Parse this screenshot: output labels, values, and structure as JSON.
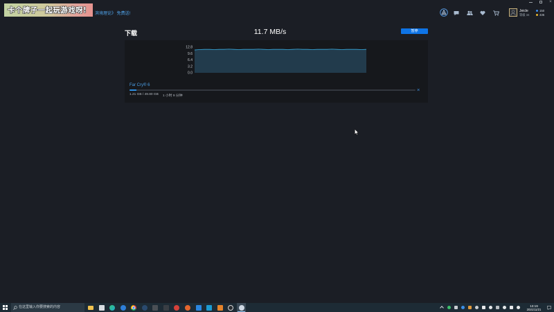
{
  "promo": {
    "banner_text": "卡个牌子一起玩游戏呀!",
    "link_text": "滨境理论》 免费送!"
  },
  "header": {
    "icons": [
      "ubisoft-logo-icon",
      "chat-icon",
      "friends-icon",
      "wishlist-heart-icon",
      "cart-icon"
    ],
    "user": {
      "name": "Jeicle",
      "level": "等级 34"
    },
    "wallet": {
      "units": "150",
      "coins": "435"
    }
  },
  "window_controls": [
    "minimize-icon",
    "restore-icon",
    "close-icon"
  ],
  "download": {
    "title": "下载",
    "speed": "11.7 MB/s",
    "pause_label": "暂停",
    "game_title": "Far Cry® 6",
    "size_progress": "1.21 GB / 49.80 GB",
    "time_remaining": "1 小时 9 分钟",
    "progress": 0.024
  },
  "colors": {
    "accent": "#0e74e6",
    "link": "#4c9fe6",
    "background": "#1b1e25",
    "panel": "#16181c"
  },
  "chart_data": {
    "type": "area",
    "values": [
      11.4,
      11.6,
      11.7,
      11.7,
      11.6,
      11.7,
      11.7,
      11.8,
      11.7,
      11.6,
      11.7,
      11.7,
      11.7,
      11.8,
      11.7,
      11.6,
      11.7,
      11.7,
      11.7,
      11.6,
      11.7,
      11.8,
      11.7,
      11.7,
      11.6,
      11.7,
      11.7,
      11.7,
      11.8,
      11.7,
      11.6,
      11.7,
      11.7,
      11.7,
      11.6,
      11.7
    ],
    "ylim": [
      0,
      12.8
    ],
    "ytick_labels": [
      "12.8",
      "9.6",
      "6.4",
      "3.2",
      "0.0"
    ],
    "grid": false,
    "line_color": "#37a9dd",
    "fill_color": "#223b4c"
  },
  "taskbar": {
    "search_placeholder": "在这里输入你要搜索的内容",
    "apps": [
      {
        "icon": "file-explorer-icon",
        "color": "#f0c24f",
        "shape": "sq"
      },
      {
        "icon": "store-icon",
        "color": "#d9dde2",
        "shape": "sq"
      },
      {
        "icon": "edge-icon",
        "color": "#1faad0",
        "shape": "round"
      },
      {
        "icon": "browser-icon",
        "color": "#2e7fd9",
        "shape": "round"
      },
      {
        "icon": "chrome-icon",
        "color": "#e0b13a",
        "shape": "round"
      },
      {
        "icon": "steam-icon",
        "color": "#2a4a6e",
        "shape": "round"
      },
      {
        "icon": "app-icon",
        "color": "#4a4f55",
        "shape": "sq"
      },
      {
        "icon": "app-icon",
        "color": "#393e44",
        "shape": "sq"
      },
      {
        "icon": "netease-music-icon",
        "color": "#d4413a",
        "shape": "round"
      },
      {
        "icon": "app-icon",
        "color": "#e4662e",
        "shape": "round"
      },
      {
        "icon": "app-icon",
        "color": "#2a86e0",
        "shape": "sq"
      },
      {
        "icon": "app-icon",
        "color": "#1c9bd1",
        "shape": "sq"
      },
      {
        "icon": "app-icon",
        "color": "#e5832a",
        "shape": "sq"
      },
      {
        "icon": "obs-icon",
        "color": "#d7d7d7",
        "shape": "round"
      },
      {
        "icon": "ubisoft-connect-icon",
        "color": "#cfd8e3",
        "shape": "round",
        "active": true
      }
    ],
    "tray_icons": [
      {
        "icon": "chevron-up-icon",
        "color": "#d5d9dd"
      },
      {
        "icon": "tray-app-icon",
        "color": "#3cbf6b"
      },
      {
        "icon": "tray-app-icon",
        "color": "#c9cdd1"
      },
      {
        "icon": "tray-app-icon",
        "color": "#3b8ee6"
      },
      {
        "icon": "tray-app-icon",
        "color": "#e09a3c"
      },
      {
        "icon": "tray-app-icon",
        "color": "#c9cdd1"
      },
      {
        "icon": "tray-app-icon",
        "color": "#e6e8ea"
      },
      {
        "icon": "tray-app-icon",
        "color": "#e6e8ea"
      },
      {
        "icon": "tray-app-icon",
        "color": "#b9bec3"
      },
      {
        "icon": "network-icon",
        "color": "#e6e8ea"
      },
      {
        "icon": "volume-icon",
        "color": "#e6e8ea"
      },
      {
        "icon": "input-method-icon",
        "color": "#e6e8ea"
      }
    ],
    "clock": {
      "time": "13:19",
      "date": "2021/11/21"
    }
  }
}
